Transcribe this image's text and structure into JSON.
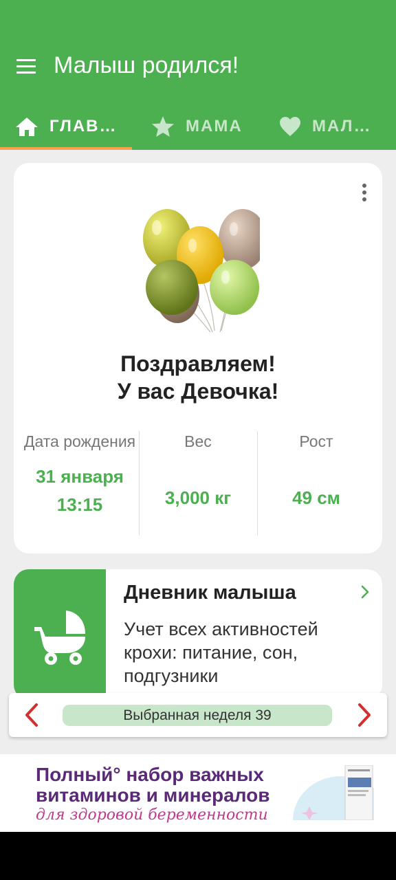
{
  "app_bar": {
    "title": "Малыш родился!",
    "menu_icon": "hamburger-menu-icon",
    "color": "#4caf50"
  },
  "tabs": [
    {
      "label": "ГЛАВ…",
      "icon": "home-icon",
      "active": true
    },
    {
      "label": "МАМА",
      "icon": "star-icon",
      "active": false
    },
    {
      "label": "МАЛ…",
      "icon": "heart-icon",
      "active": false
    }
  ],
  "tab_indicator_color": "#f6a24b",
  "birth_card": {
    "congrats_line1": "Поздравляем!",
    "congrats_line2": "У вас Девочка!",
    "image": "balloons-illustration",
    "more_icon": "more-vert-icon",
    "stats": [
      {
        "label": "Дата рождения",
        "value": "31 января 13:15"
      },
      {
        "label": "Вес",
        "value": "3,000 кг"
      },
      {
        "label": "Рост",
        "value": "49 см"
      }
    ],
    "accent_color": "#4caf50"
  },
  "diary_card": {
    "title": "Дневник малыша",
    "description": "Учет всех активностей крохи: питание, сон, подгузники",
    "icon": "baby-stroller-icon",
    "chevron_icon": "chevron-right-icon"
  },
  "week_selector": {
    "label": "Выбранная неделя 39",
    "prev_icon": "chevron-left-icon",
    "next_icon": "chevron-right-icon",
    "arrow_color": "#d32f2f"
  },
  "ad_banner": {
    "line1": "Полный° набор важных",
    "line2": "витаминов и минералов",
    "line3": "для здоровой беременности"
  }
}
